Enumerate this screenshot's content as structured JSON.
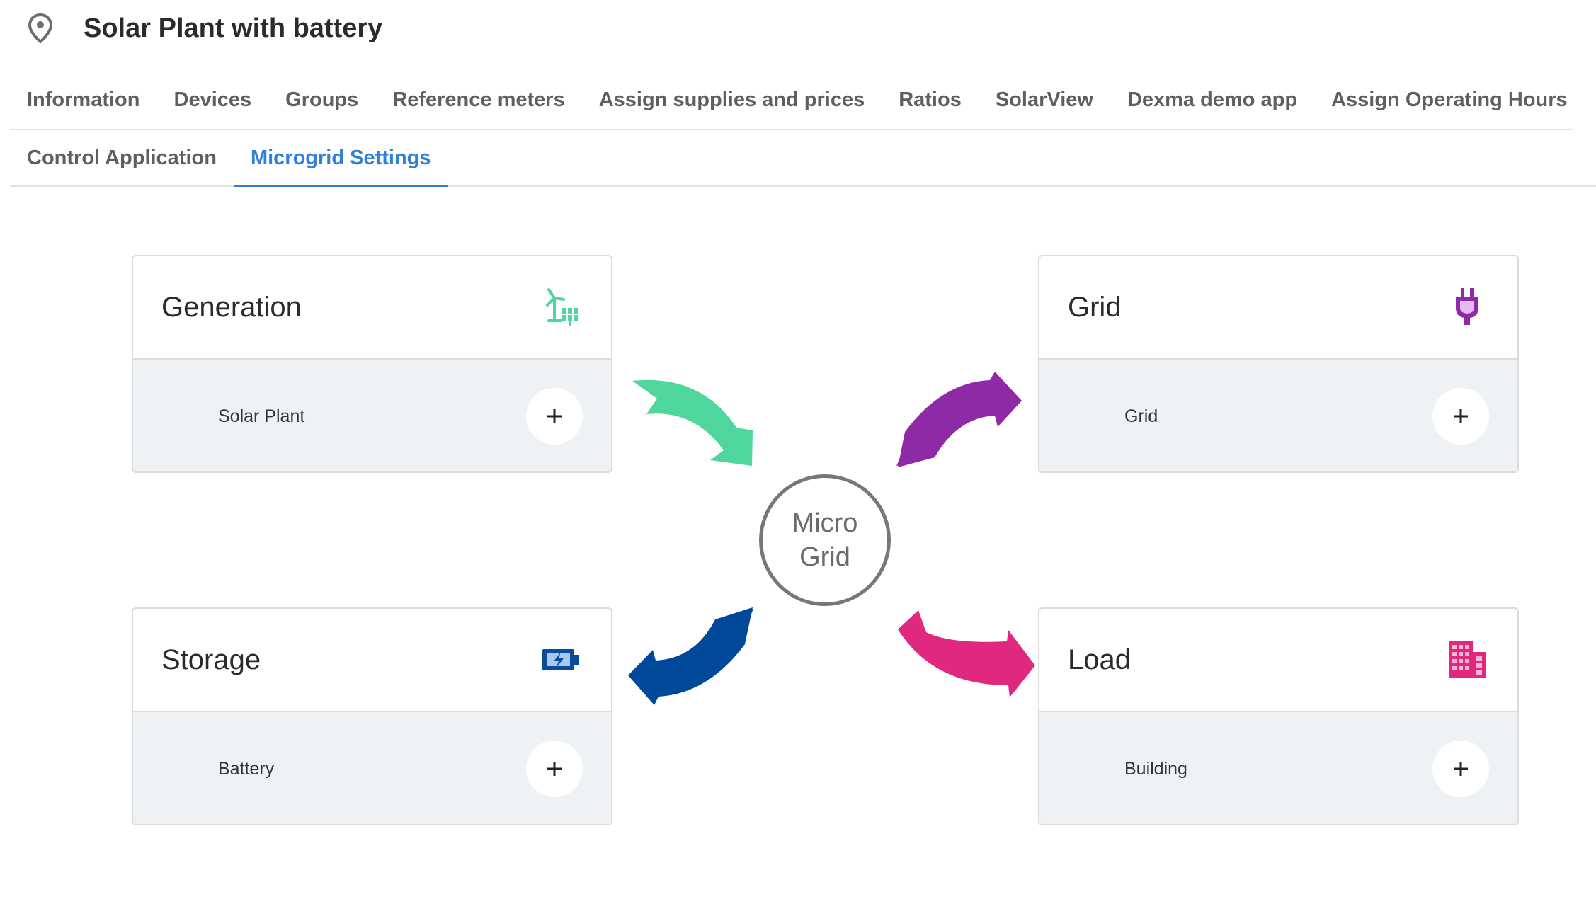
{
  "header": {
    "title": "Solar Plant with battery",
    "icon": "location-pin-icon"
  },
  "tabs": {
    "row1": [
      {
        "label": "Information"
      },
      {
        "label": "Devices"
      },
      {
        "label": "Groups"
      },
      {
        "label": "Reference meters"
      },
      {
        "label": "Assign supplies and prices"
      },
      {
        "label": "Ratios"
      },
      {
        "label": "SolarView"
      },
      {
        "label": "Dexma demo app"
      },
      {
        "label": "Assign Operating Hours"
      }
    ],
    "row2": [
      {
        "label": "Control Application"
      },
      {
        "label": "Microgrid Settings",
        "active": true
      }
    ]
  },
  "center": {
    "line1": "Micro",
    "line2": "Grid"
  },
  "cards": {
    "generation": {
      "title": "Generation",
      "item": "Solar Plant",
      "icon": "generation-icon",
      "color": "#4fd69c"
    },
    "grid": {
      "title": "Grid",
      "item": "Grid",
      "icon": "plug-icon",
      "color": "#8e2aa6"
    },
    "storage": {
      "title": "Storage",
      "item": "Battery",
      "icon": "battery-icon",
      "color": "#0a4c9c"
    },
    "load": {
      "title": "Load",
      "item": "Building",
      "icon": "building-icon",
      "color": "#e0287f"
    }
  },
  "colors": {
    "accent": "#2f80d6",
    "generation": "#4fd69c",
    "grid": "#8e2aa6",
    "storage": "#00499a",
    "load": "#e0287f"
  }
}
